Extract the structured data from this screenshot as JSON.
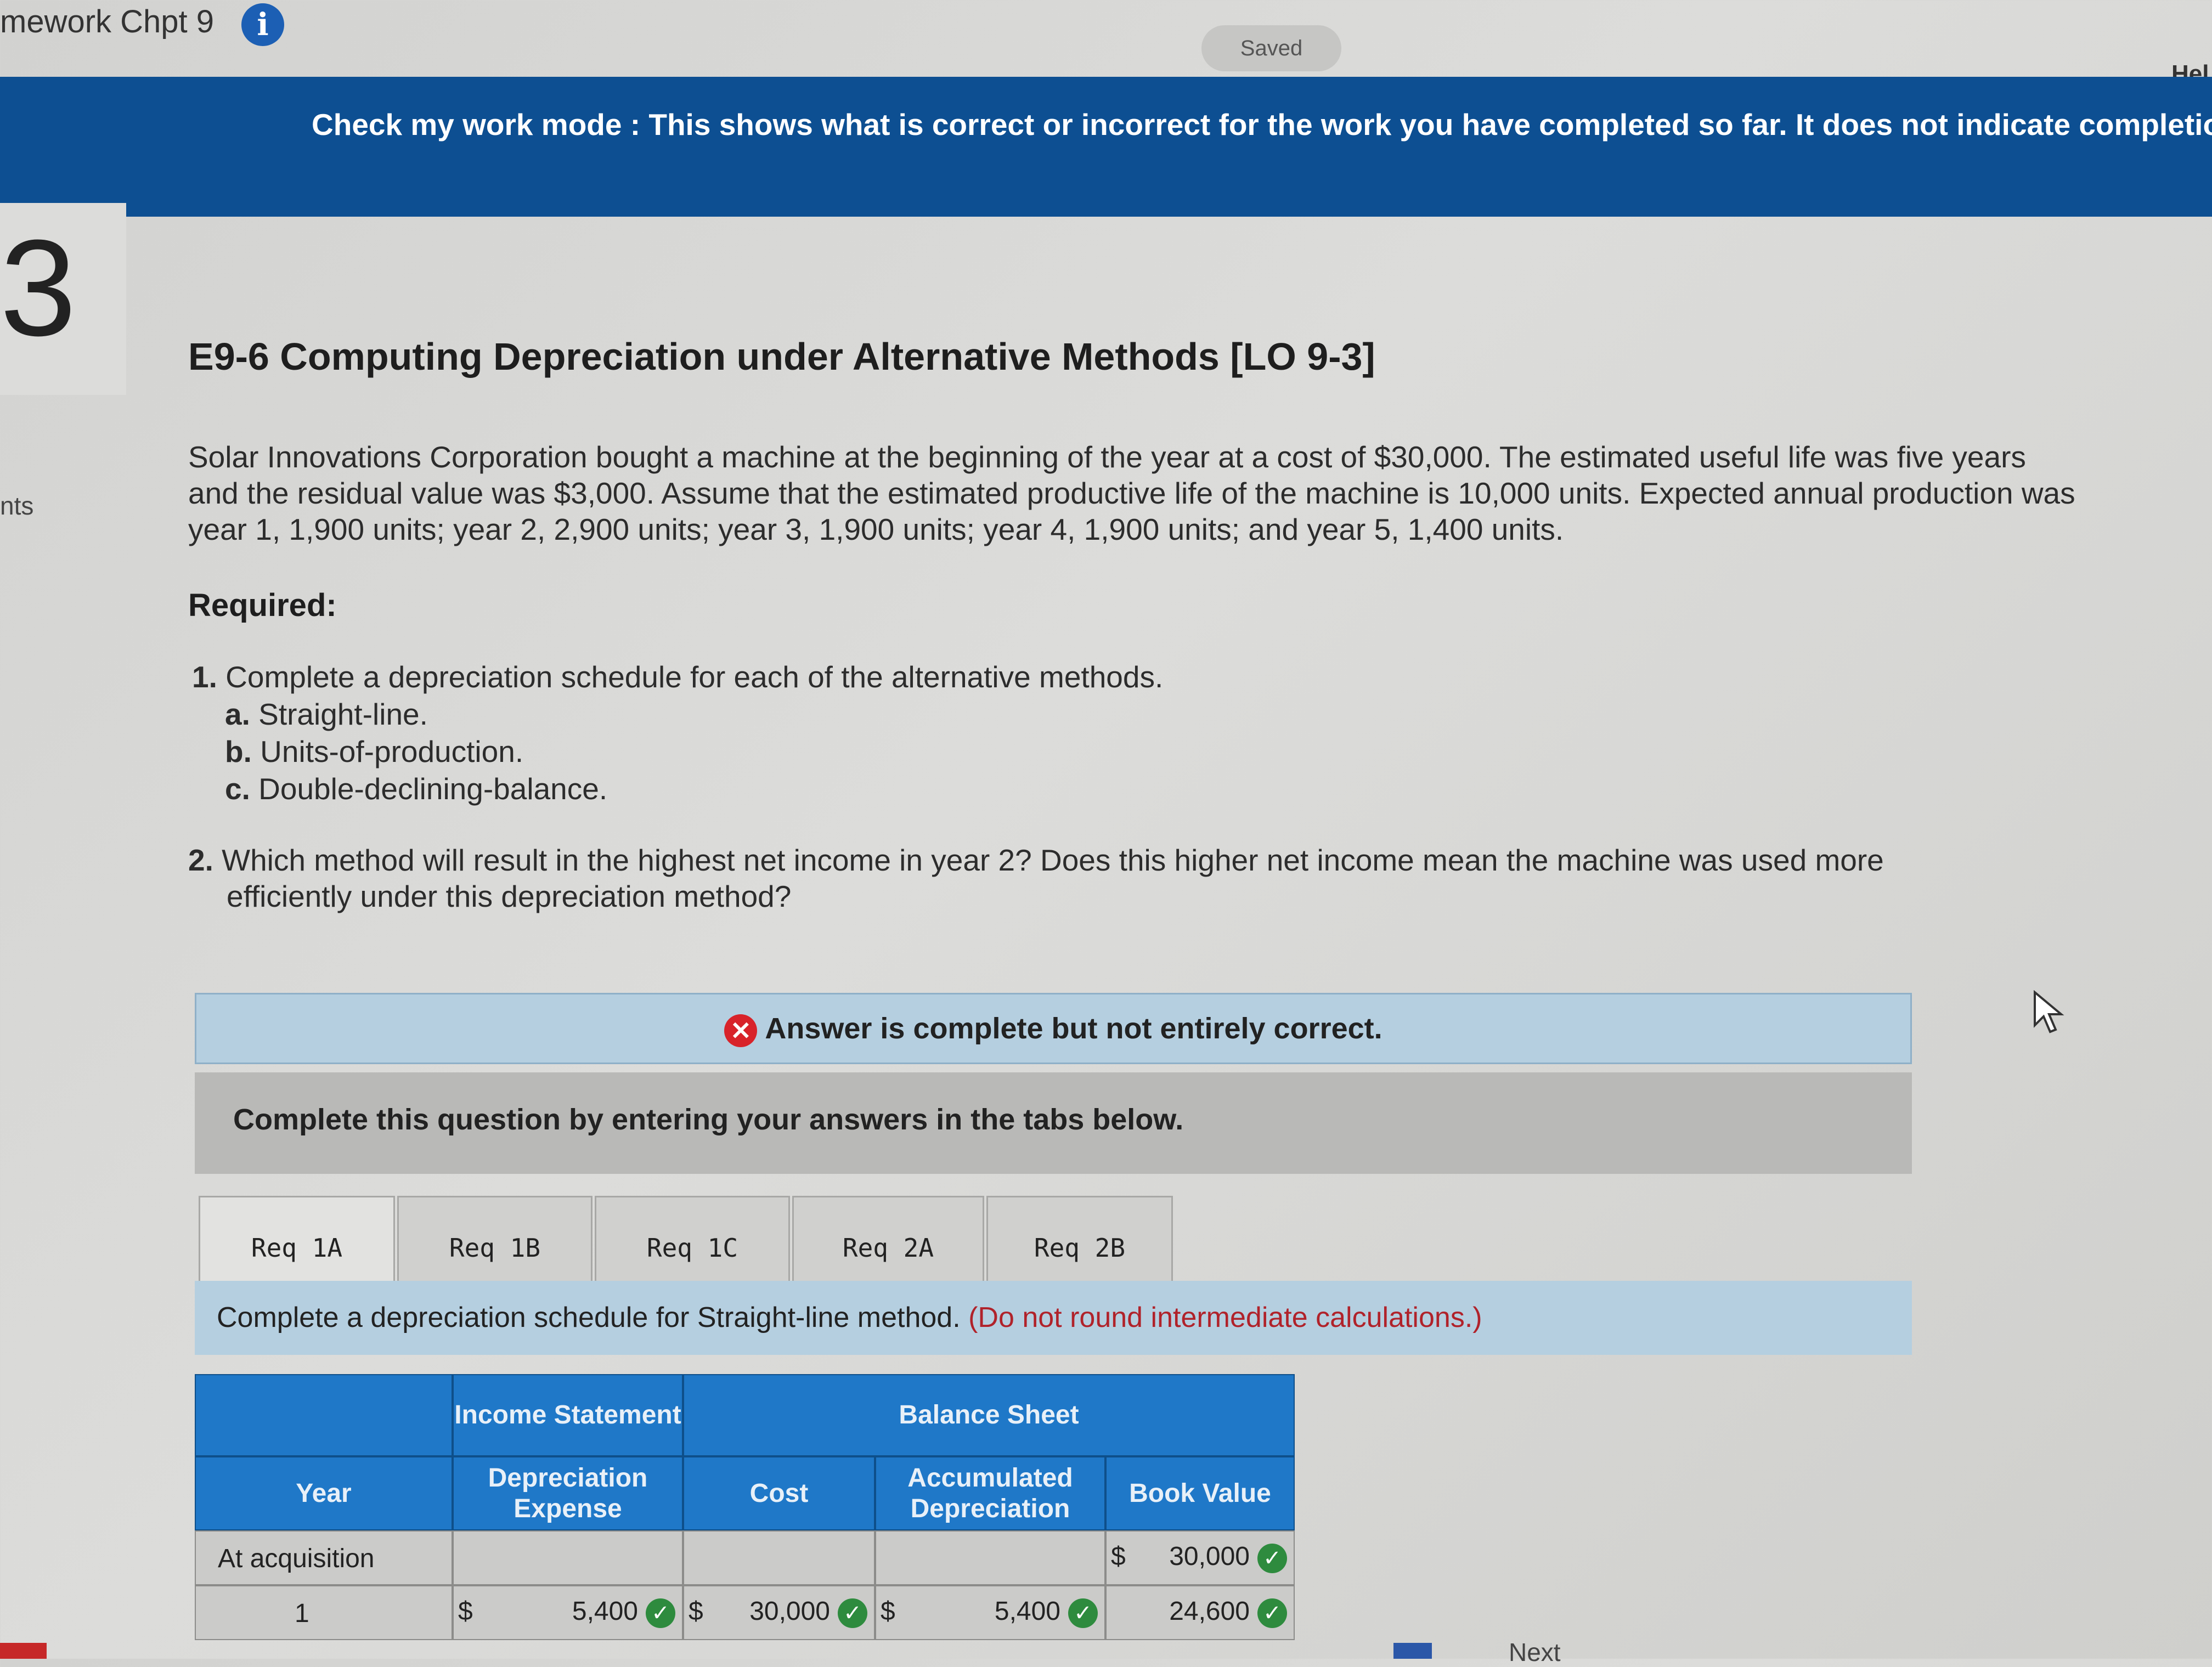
{
  "header": {
    "assignment_title": "mework Chpt 9",
    "info_glyph": "i",
    "saved_label": "Saved",
    "help_label": "Hel"
  },
  "banner": {
    "text": "Check my work mode : This shows what is correct or incorrect for the work you have completed so far. It does not indicate completio"
  },
  "sidebar": {
    "question_number": "3",
    "points_label": "nts"
  },
  "question": {
    "title": "E9-6 Computing Depreciation under Alternative Methods [LO 9-3]",
    "paragraph": "Solar Innovations Corporation bought a machine at the beginning of the year at a cost of $30,000. The estimated useful life was five years and the residual value was $3,000. Assume that the estimated productive life of the machine is 10,000 units. Expected annual production was year 1, 1,900 units; year 2, 2,900 units; year 3, 1,900 units; year 4, 1,900 units; and year 5, 1,400 units.",
    "required_label": "Required:",
    "req1_num": "1.",
    "req1_text": "Complete a depreciation schedule for each of the alternative methods.",
    "req1a_letter": "a.",
    "req1a_text": "Straight-line.",
    "req1b_letter": "b.",
    "req1b_text": "Units-of-production.",
    "req1c_letter": "c.",
    "req1c_text": "Double-declining-balance.",
    "req2_num": "2.",
    "req2_line1": "Which method will result in the highest net income in year 2? Does this higher net income mean the machine was used more",
    "req2_line2": "efficiently under this depreciation method?"
  },
  "status": {
    "icon": "✕",
    "message": "Answer is complete but not entirely correct."
  },
  "instructions": {
    "text": "Complete this question by entering your answers in the tabs below."
  },
  "tabs": [
    {
      "label": "Req 1A"
    },
    {
      "label": "Req 1B"
    },
    {
      "label": "Req 1C"
    },
    {
      "label": "Req 2A"
    },
    {
      "label": "Req 2B"
    }
  ],
  "tab_description": {
    "text": "Complete a depreciation schedule for Straight-line method.",
    "note": "(Do not round intermediate calculations.)"
  },
  "table": {
    "group_income": "Income Statement",
    "group_balance": "Balance Sheet",
    "col_year": "Year",
    "col_depreciation": "Depreciation Expense",
    "col_cost": "Cost",
    "col_accumulated": "Accumulated Depreciation",
    "col_book": "Book Value",
    "currency": "$",
    "check_glyph": "✓",
    "rows": [
      {
        "year": "At acquisition",
        "depreciation": "",
        "cost": "",
        "accumulated": "",
        "book": "30,000"
      },
      {
        "year": "1",
        "depreciation": "5,400",
        "cost": "30,000",
        "accumulated": "5,400",
        "book": "24,600"
      }
    ]
  },
  "footer": {
    "next_label": "Next"
  }
}
